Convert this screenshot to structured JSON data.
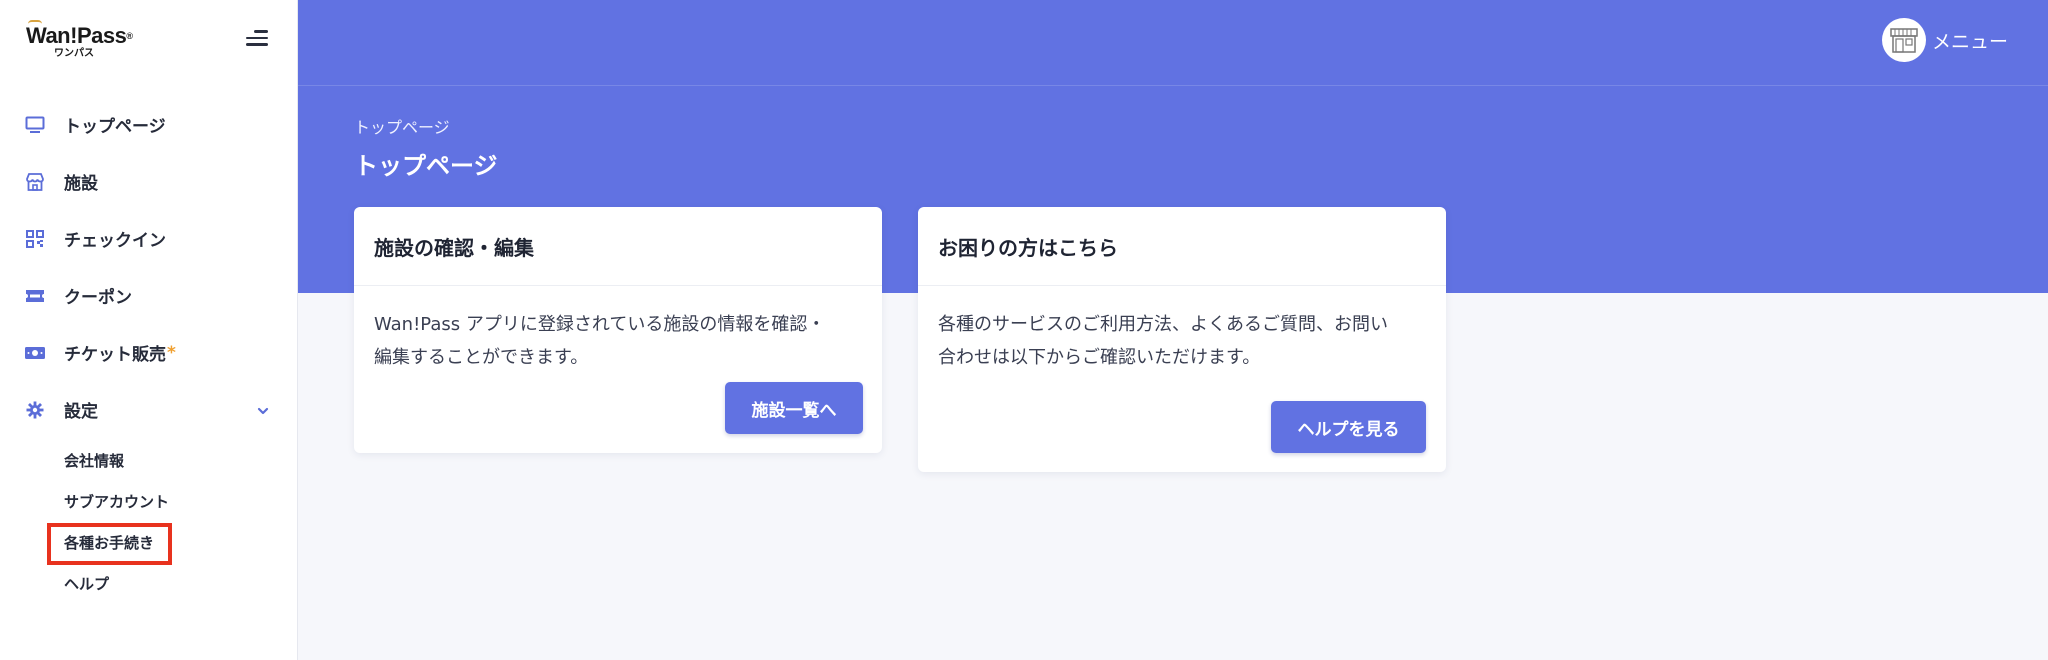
{
  "brand": {
    "name": "Wan!Pass",
    "registered": "®",
    "kana": "ワンパス"
  },
  "sidebar": {
    "items": [
      {
        "label": "トップページ",
        "icon": "monitor-icon"
      },
      {
        "label": "施設",
        "icon": "store-icon"
      },
      {
        "label": "チェックイン",
        "icon": "qr-code-icon"
      },
      {
        "label": "クーポン",
        "icon": "ticket-icon"
      },
      {
        "label": "チケット販売",
        "icon": "money-icon",
        "badge": "*"
      },
      {
        "label": "設定",
        "icon": "gear-icon"
      }
    ],
    "settings_sub": [
      {
        "label": "会社情報"
      },
      {
        "label": "サブアカウント"
      },
      {
        "label": "各種お手続き"
      },
      {
        "label": "ヘルプ"
      }
    ]
  },
  "header": {
    "menu_label": "メニュー"
  },
  "page": {
    "breadcrumb": "トップページ",
    "title": "トップページ"
  },
  "cards": [
    {
      "title": "施設の確認・編集",
      "body_line1": "Wan!Pass アプリに登録されている施設の情報を確認・",
      "body_line2": "編集することができます。",
      "button": "施設一覧へ"
    },
    {
      "title": "お困りの方はこちら",
      "body_line1": "各種のサービスのご利用方法、よくあるご質問、お問い",
      "body_line2": "合わせは以下からご確認いただけます。",
      "button": "ヘルプを見る"
    }
  ],
  "colors": {
    "accent": "#6172e2",
    "sidebar_icon": "#5b6dd8",
    "highlight": "#e8321e",
    "badge": "#f0a030"
  }
}
